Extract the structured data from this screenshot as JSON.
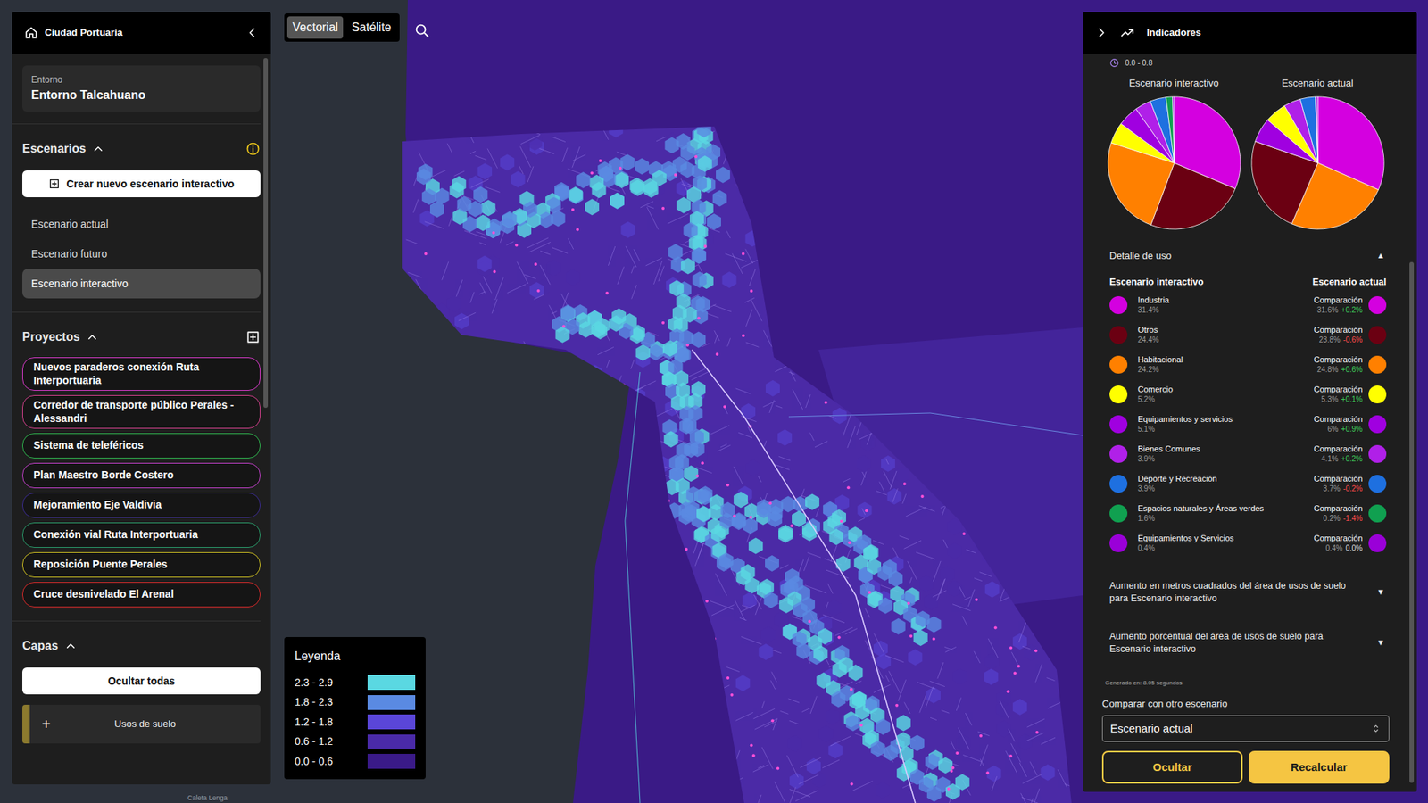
{
  "left_panel": {
    "title": "Ciudad Portuaria"
  },
  "entorno": {
    "label": "Entorno",
    "value": "Entorno Talcahuano"
  },
  "escenarios": {
    "title": "Escenarios",
    "expanded": true,
    "create_label": "Crear nuevo escenario interactivo",
    "items": [
      {
        "label": "Escenario actual",
        "selected": false
      },
      {
        "label": "Escenario futuro",
        "selected": false
      },
      {
        "label": "Escenario interactivo",
        "selected": true
      }
    ]
  },
  "proyectos": {
    "title": "Proyectos",
    "expanded": true,
    "items": [
      {
        "label": "Nuevos paraderos conexión Ruta Interportuaria",
        "color": "#d63ac8"
      },
      {
        "label": "Corredor de transporte público Perales - Alessandri",
        "color": "#d0408a"
      },
      {
        "label": "Sistema de teleféricos",
        "color": "#2fb34e"
      },
      {
        "label": "Plan Maestro Borde Costero",
        "color": "#c040c8"
      },
      {
        "label": "Mejoramiento Eje Valdivia",
        "color": "#3b2c8e"
      },
      {
        "label": "Conexión vial Ruta Interportuaria",
        "color": "#2a9a6a"
      },
      {
        "label": "Reposición Puente Perales",
        "color": "#cbbd22"
      },
      {
        "label": "Cruce desnivelado El Arenal",
        "color": "#d42a2a"
      }
    ]
  },
  "capas": {
    "title": "Capas",
    "expanded": true,
    "hide_all_label": "Ocultar todas",
    "items": [
      {
        "label": "Usos de suelo",
        "icon": "+",
        "color": "#8c7a2e"
      }
    ]
  },
  "map_modes": [
    {
      "label": "Vectorial",
      "selected": true
    },
    {
      "label": "Satélite",
      "selected": false
    }
  ],
  "legend": {
    "title": "Leyenda",
    "items": [
      {
        "label": "2.3 - 2.9",
        "color": "#5ad8e2"
      },
      {
        "label": "1.8 - 2.3",
        "color": "#5a8ae2"
      },
      {
        "label": "1.2 - 1.8",
        "color": "#5a46d8"
      },
      {
        "label": "0.6 - 1.2",
        "color": "#4a2aa8"
      },
      {
        "label": "0.0 - 0.6",
        "color": "#3a1a88"
      }
    ]
  },
  "map_labels": [
    "Caleta Lenga"
  ],
  "indicators": {
    "title": "Indicadores",
    "range": "0.0 - 0.8",
    "pies": [
      {
        "title": "Escenario interactivo",
        "slices": [
          {
            "value": 31.4,
            "color": "#d400e0"
          },
          {
            "value": 24.4,
            "color": "#6b0012"
          },
          {
            "value": 24.2,
            "color": "#ff8000"
          },
          {
            "value": 5.2,
            "color": "#ffff00"
          },
          {
            "value": 5.1,
            "color": "#a000e0"
          },
          {
            "value": 3.9,
            "color": "#b020e8"
          },
          {
            "value": 3.9,
            "color": "#1e70e0"
          },
          {
            "value": 1.6,
            "color": "#10a050"
          },
          {
            "value": 0.4,
            "color": "#9a00d8"
          }
        ]
      },
      {
        "title": "Escenario actual",
        "slices": [
          {
            "value": 31.6,
            "color": "#d400e0"
          },
          {
            "value": 24.8,
            "color": "#ff8000"
          },
          {
            "value": 23.8,
            "color": "#6b0012"
          },
          {
            "value": 6,
            "color": "#a000e0"
          },
          {
            "value": 5.3,
            "color": "#ffff00"
          },
          {
            "value": 4.1,
            "color": "#b020e8"
          },
          {
            "value": 3.7,
            "color": "#1e70e0"
          },
          {
            "value": 0.2,
            "color": "#10a050"
          },
          {
            "value": 0.4,
            "color": "#9a00d8"
          }
        ]
      }
    ],
    "detail": {
      "title": "Detalle de uso",
      "expanded": true,
      "toggle_icon": "▲",
      "left_heading": "Escenario interactivo",
      "right_heading": "Escenario actual",
      "rows": [
        {
          "name": "Industria",
          "value": "31.4%",
          "compare_label": "Comparación",
          "compare_value": "31.6%",
          "delta": "+0.2%",
          "trend": "up",
          "color": "#d400e0"
        },
        {
          "name": "Otros",
          "value": "24.4%",
          "compare_label": "Comparación",
          "compare_value": "23.8%",
          "delta": "-0.6%",
          "trend": "down",
          "color": "#6b0012"
        },
        {
          "name": "Habitacional",
          "value": "24.2%",
          "compare_label": "Comparación",
          "compare_value": "24.8%",
          "delta": "+0.6%",
          "trend": "up",
          "color": "#ff8000"
        },
        {
          "name": "Comercio",
          "value": "5.2%",
          "compare_label": "Comparación",
          "compare_value": "5.3%",
          "delta": "+0.1%",
          "trend": "up",
          "color": "#ffff00"
        },
        {
          "name": "Equipamientos y servicios",
          "value": "5.1%",
          "compare_label": "Comparación",
          "compare_value": "6%",
          "delta": "+0.9%",
          "trend": "up",
          "color": "#a000e0"
        },
        {
          "name": "Bienes Comunes",
          "value": "3.9%",
          "compare_label": "Comparación",
          "compare_value": "4.1%",
          "delta": "+0.2%",
          "trend": "up",
          "color": "#b020e8"
        },
        {
          "name": "Deporte y Recreación",
          "value": "3.9%",
          "compare_label": "Comparación",
          "compare_value": "3.7%",
          "delta": "-0.2%",
          "trend": "down",
          "color": "#1e70e0"
        },
        {
          "name": "Espacios naturales y Áreas verdes",
          "value": "1.6%",
          "compare_label": "Comparación",
          "compare_value": "0.2%",
          "delta": "-1.4%",
          "trend": "down",
          "color": "#10a050"
        },
        {
          "name": "Equipamientos y Servicios",
          "value": "0.4%",
          "compare_label": "Comparación",
          "compare_value": "0.4%",
          "delta": "0.0%",
          "trend": "flat",
          "color": "#9a00d8"
        }
      ]
    },
    "collapsibles": [
      {
        "text": "Aumento en metros cuadrados del área de usos de suelo para Escenario interactivo",
        "expanded": false,
        "icon": "▼"
      },
      {
        "text": "Aumento porcentual del área de usos de suelo para Escenario interactivo",
        "expanded": false,
        "icon": "▼"
      }
    ],
    "generated": "Generado en: 8.05 segundos",
    "compare": {
      "label": "Comparar con otro escenario",
      "value": "Escenario actual"
    },
    "buttons": [
      {
        "label": "Ocultar",
        "kind": "outline"
      },
      {
        "label": "Recalcular",
        "kind": "primary"
      }
    ]
  }
}
